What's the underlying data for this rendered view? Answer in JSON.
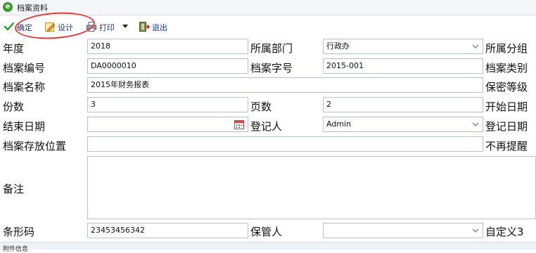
{
  "window": {
    "title": "档案资料"
  },
  "toolbar": {
    "confirm_label": "确定",
    "design_label": "设计",
    "print_label": "打印",
    "exit_label": "退出"
  },
  "form": {
    "year_label": "年度",
    "year_value": "2018",
    "dept_label": "所属部门",
    "dept_value": "行政办",
    "group_label": "所属分组",
    "archive_no_label": "档案编号",
    "archive_no_value": "DA0000010",
    "archive_word_label": "档案字号",
    "archive_word_value": "2015-001",
    "category_label": "档案类别",
    "name_label": "档案名称",
    "name_value": "2015年财务报表",
    "secret_label": "保密等级",
    "copies_label": "份数",
    "copies_value": "3",
    "pages_label": "页数",
    "pages_value": "2",
    "start_date_label": "开始日期",
    "end_date_label": "结束日期",
    "end_date_value": "",
    "registrar_label": "登记人",
    "registrar_value": "Admin",
    "reg_date_label": "登记日期",
    "location_label": "档案存放位置",
    "location_value": "",
    "no_remind_label": "不再提醒",
    "remark_label": "备注",
    "remark_value": "",
    "barcode_label": "条形码",
    "barcode_value": "23453456342",
    "keeper_label": "保管人",
    "keeper_value": "",
    "custom3_label": "自定义3"
  },
  "attachment": {
    "section_label": "附件信息"
  },
  "colors": {
    "input_border": "#b9c3cf",
    "toolbar_text": "#1a3d8f",
    "annotation": "#e33b3b"
  }
}
